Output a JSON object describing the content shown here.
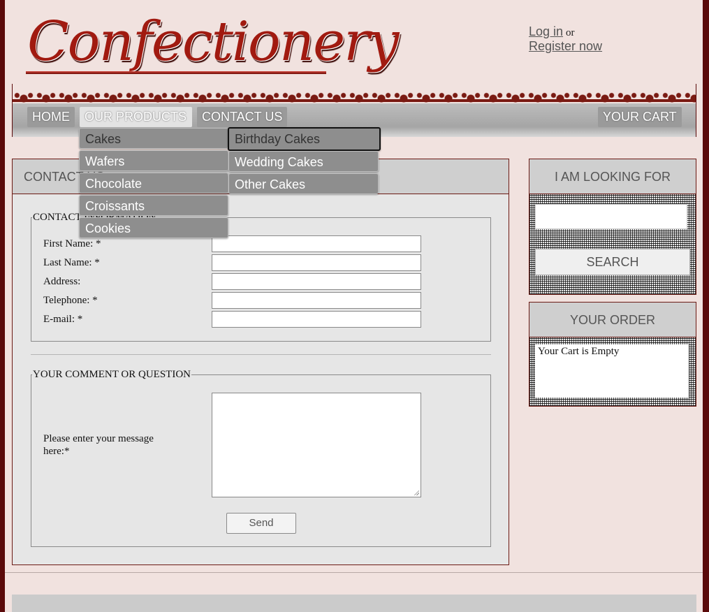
{
  "header": {
    "logo_text": "Confectionery",
    "login_label": "Log in",
    "or_text": "or",
    "register_label": "Register now"
  },
  "nav": {
    "home": "HOME",
    "products": "OUR PRODUCTS",
    "contact": "CONTACT US",
    "cart": "YOUR CART"
  },
  "products_menu": [
    "Cakes",
    "Wafers",
    "Chocolate",
    "Croissants",
    "Cookies"
  ],
  "cakes_submenu": [
    "Birthday Cakes",
    "Wedding Cakes",
    "Other Cakes"
  ],
  "main": {
    "title": "CONTACT US",
    "contact_legend": "CONTACT INFORMATION",
    "fields": [
      "First Name: *",
      "Last Name: *",
      "Address:",
      "Telephone: *",
      "E-mail: *"
    ],
    "comment_legend": "YOUR COMMENT OR QUESTION",
    "message_label": "Please enter your message here:*",
    "send_label": "Send"
  },
  "sidebar": {
    "search_title": "I AM LOOKING FOR",
    "search_value": "",
    "search_button": "SEARCH",
    "order_title": "YOUR ORDER",
    "cart_status": "Your Cart is Empty"
  },
  "colors": {
    "frame": "#5a0a0a",
    "page_bg": "#f1e2df",
    "panel_bg": "#e6e6e6",
    "header_gray": "#cfcfcf",
    "menu_gray": "#8e8e8e",
    "logo_red": "#a11a10"
  }
}
